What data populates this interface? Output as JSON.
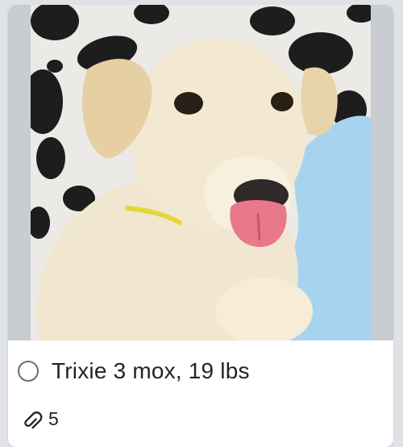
{
  "card": {
    "title": "Trixie 3 mox, 19 lbs",
    "attachments_count": "5",
    "completed": false
  },
  "cover": {
    "subject": "puppy-photo"
  },
  "icons": {
    "checkbox": "circle-checkbox-icon",
    "attachments": "paperclip-icon"
  },
  "colors": {
    "board_background": "#dfe3e8",
    "card_background": "#ffffff",
    "cover_background": "#c9ccd0",
    "text": "#1f2328"
  }
}
